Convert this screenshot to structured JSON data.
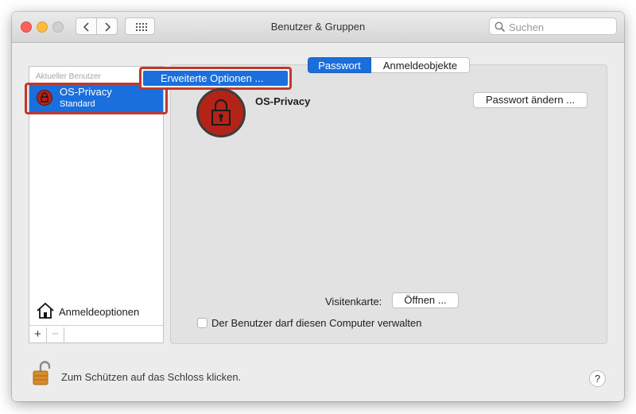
{
  "window": {
    "title": "Benutzer & Gruppen"
  },
  "search": {
    "placeholder": "Suchen"
  },
  "sidebar": {
    "section_header": "Aktueller Benutzer",
    "current_user": {
      "name": "OS-Privacy",
      "role": "Standard"
    },
    "login_options_label": "Anmeldeoptionen",
    "add_symbol": "+",
    "remove_symbol": "−"
  },
  "context_menu": {
    "item_label": "Erweiterte Optionen ..."
  },
  "tabs": [
    {
      "label": "Passwort"
    },
    {
      "label": "Anmeldeobjekte"
    }
  ],
  "main": {
    "full_name": "OS-Privacy",
    "change_password_label": "Passwort ändern ...",
    "contact_card_label": "Visitenkarte:",
    "open_button_label": "Öffnen ...",
    "admin_checkbox_label": "Der Benutzer darf diesen Computer verwalten",
    "admin_checkbox_checked": false
  },
  "footer": {
    "lock_text": "Zum Schützen auf das Schloss klicken.",
    "help_symbol": "?"
  },
  "colors": {
    "selection": "#1b6fdd",
    "avatar": "#b42318",
    "highlight_border": "#c0392b"
  }
}
